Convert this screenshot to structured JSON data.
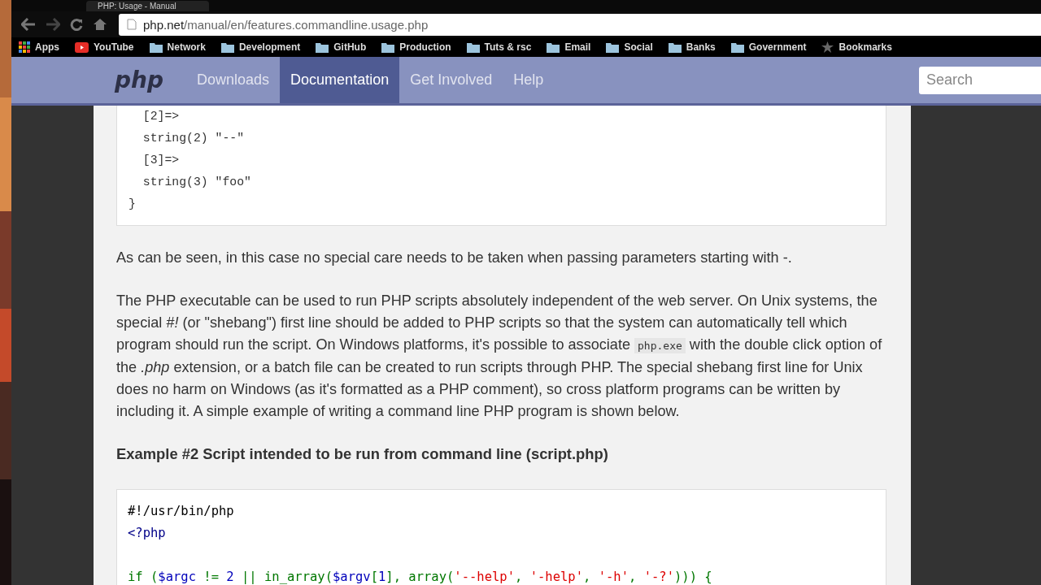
{
  "browser": {
    "tab_title": "PHP: Usage - Manual",
    "url_host": "php.net",
    "url_path": "/manual/en/features.commandline.usage.php",
    "bookmarks": [
      {
        "label": "Apps",
        "kind": "apps"
      },
      {
        "label": "YouTube",
        "kind": "youtube"
      },
      {
        "label": "Network",
        "kind": "folder"
      },
      {
        "label": "Development",
        "kind": "folder"
      },
      {
        "label": "GitHub",
        "kind": "folder"
      },
      {
        "label": "Production",
        "kind": "folder"
      },
      {
        "label": "Tuts & rsc",
        "kind": "folder"
      },
      {
        "label": "Email",
        "kind": "folder"
      },
      {
        "label": "Social",
        "kind": "folder"
      },
      {
        "label": "Banks",
        "kind": "folder"
      },
      {
        "label": "Government",
        "kind": "folder"
      },
      {
        "label": "Bookmarks",
        "kind": "star"
      }
    ]
  },
  "site_nav": {
    "logo": "php",
    "items": [
      {
        "label": "Downloads",
        "selected": false
      },
      {
        "label": "Documentation",
        "selected": true
      },
      {
        "label": "Get Involved",
        "selected": false
      },
      {
        "label": "Help",
        "selected": false
      }
    ],
    "search": {
      "placeholder": "Search"
    }
  },
  "output_block": [
    "  [2]=>",
    "  string(2) \"--\"",
    "  [3]=>",
    "  string(3) \"foo\"",
    "}"
  ],
  "paragraphs": [
    [
      {
        "kind": "text",
        "text": "As can be seen, in this case no special care needs to be taken when passing parameters starting with -."
      }
    ],
    [
      {
        "kind": "text",
        "text": "The PHP executable can be used to run PHP scripts absolutely independent of the web server. On Unix systems, the special *#!* (or \"shebang\") first line should be added to PHP scripts so that the system can automatically tell which program should run the script. On Windows platforms, it's possible to associate "
      },
      {
        "kind": "code",
        "text": "php.exe"
      },
      {
        "kind": "text",
        "text": " with the double click option of the *.php* extension, or a batch file can be created to run scripts through PHP. The special shebang first line for Unix does no harm on Windows (as it's formatted as a PHP comment), so cross platform programs can be written by including it. A simple example of writing a command line PHP program is shown below."
      }
    ]
  ],
  "example_title": "Example #2 Script intended to be run from command line (script.php)",
  "code_groups": [
    [
      {
        "tokens": [
          {
            "text": "#!/usr/bin/php",
            "kind": "plain"
          }
        ]
      },
      {
        "tokens": [
          {
            "text": "<?php",
            "kind": "tag"
          }
        ]
      }
    ],
    [
      {
        "tokens": [
          {
            "text": "if (",
            "kind": "keyword"
          },
          {
            "text": "$argc",
            "kind": "variable"
          },
          {
            "text": " != ",
            "kind": "keyword"
          },
          {
            "text": "2",
            "kind": "variable"
          },
          {
            "text": " || ",
            "kind": "keyword"
          },
          {
            "text": "in_array",
            "kind": "keyword"
          },
          {
            "text": "(",
            "kind": "keyword"
          },
          {
            "text": "$argv",
            "kind": "variable"
          },
          {
            "text": "[",
            "kind": "keyword"
          },
          {
            "text": "1",
            "kind": "variable"
          },
          {
            "text": "], array(",
            "kind": "keyword"
          },
          {
            "text": "'--help'",
            "kind": "string"
          },
          {
            "text": ", ",
            "kind": "keyword"
          },
          {
            "text": "'-help'",
            "kind": "string"
          },
          {
            "text": ", ",
            "kind": "keyword"
          },
          {
            "text": "'-h'",
            "kind": "string"
          },
          {
            "text": ", ",
            "kind": "keyword"
          },
          {
            "text": "'-?'",
            "kind": "string"
          },
          {
            "text": "))) {",
            "kind": "keyword"
          }
        ]
      }
    ]
  ]
}
